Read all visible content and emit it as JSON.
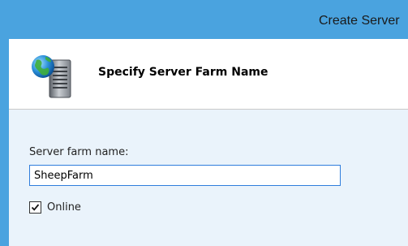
{
  "window": {
    "title": "Create Server"
  },
  "header": {
    "title": "Specify Server Farm Name",
    "icon": "server-globe-icon"
  },
  "form": {
    "server_farm_name_label": "Server farm name:",
    "server_farm_name_value": "SheepFarm",
    "online_label": "Online",
    "online_checked": true
  },
  "colors": {
    "accent": "#4aa3df",
    "content_background": "#eaf3fb",
    "input_focus_border": "#2f7ddc"
  }
}
